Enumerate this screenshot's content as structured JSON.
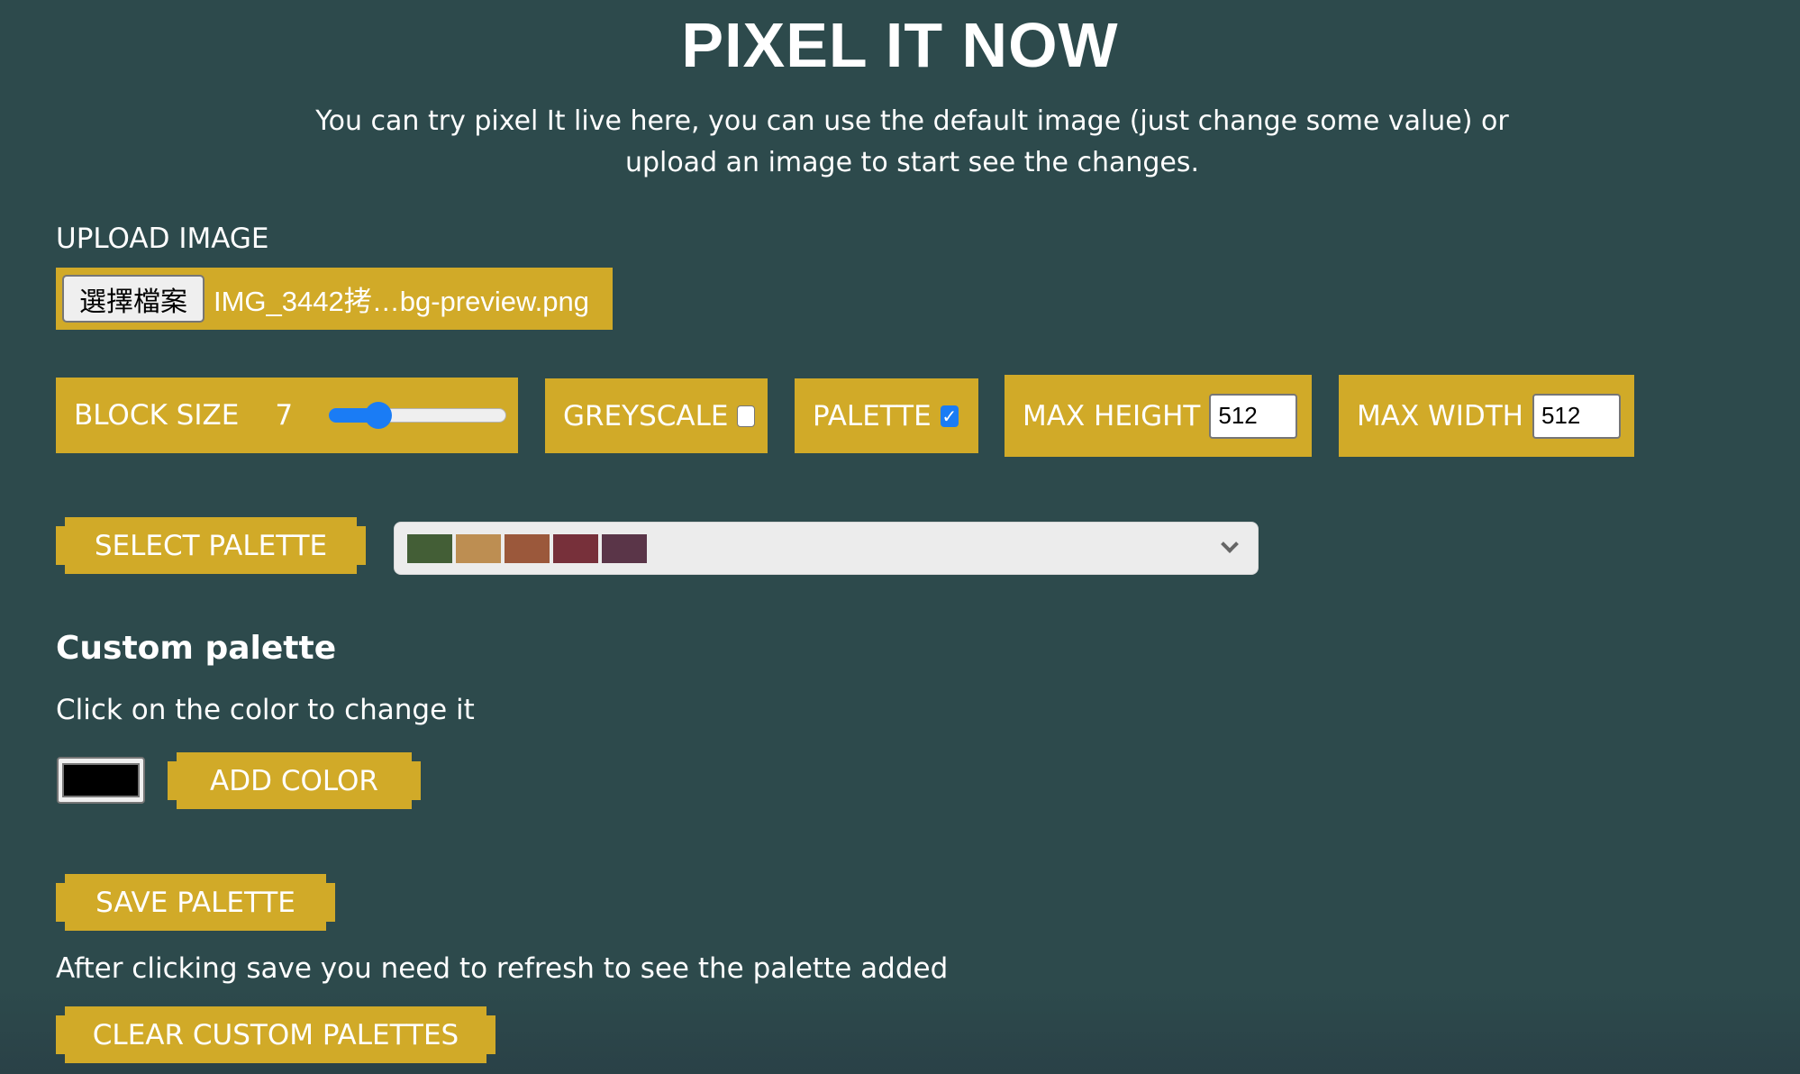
{
  "header": {
    "title": "PIXEL IT NOW",
    "subtitle": "You can try pixel It live here, you can use the default image (just change some value) or upload an image to start see the changes."
  },
  "upload": {
    "label": "UPLOAD IMAGE",
    "button_label": "選擇檔案",
    "file_name": "IMG_3442拷…bg-preview.png"
  },
  "controls": {
    "block_size": {
      "label": "BLOCK SIZE",
      "value": "7",
      "slider_fraction": 0.28
    },
    "greyscale": {
      "label": "GREYSCALE",
      "checked": false
    },
    "palette": {
      "label": "PALETTE",
      "checked": true,
      "check_glyph": "✓"
    },
    "max_height": {
      "label": "MAX HEIGHT",
      "value": "512"
    },
    "max_width": {
      "label": "MAX WIDTH",
      "value": "512"
    }
  },
  "palette_select": {
    "button_label": "SELECT PALETTE",
    "selected_colors": [
      "#435e36",
      "#bd8e52",
      "#9b583b",
      "#77303a",
      "#5a3548"
    ],
    "chevron_icon": "chevron-down-icon"
  },
  "custom_palette": {
    "heading": "Custom palette",
    "hint": "Click on the color to change it",
    "current_color": "#000000",
    "add_color_label": "ADD COLOR",
    "save_label": "SAVE PALETTE",
    "save_hint": "After clicking save you need to refresh to see the palette added",
    "clear_label": "CLEAR CUSTOM PALETTES"
  },
  "theme": {
    "background": "#2d4a4c",
    "accent": "#d1aa28",
    "control_blue": "#1a7cf5"
  }
}
